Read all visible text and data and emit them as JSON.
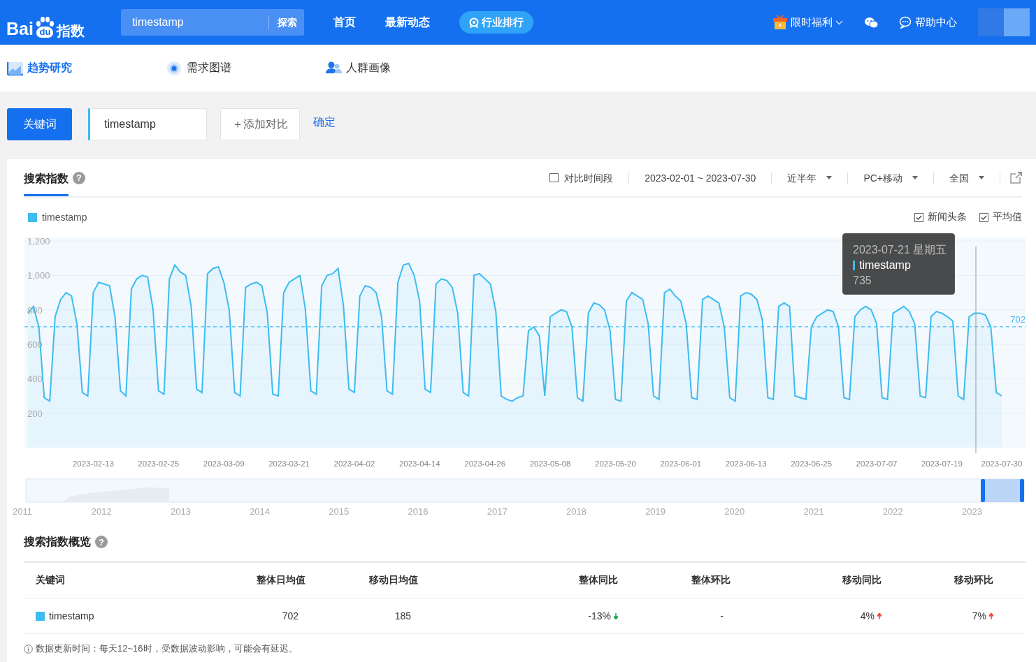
{
  "header": {
    "logo": [
      "Bai",
      "du",
      "指数"
    ],
    "search": {
      "value": "timestamp",
      "button": "探索"
    },
    "nav": [
      {
        "label": "首页",
        "kind": "link"
      },
      {
        "label": "最新动态",
        "kind": "link"
      },
      {
        "label": "行业排行",
        "kind": "pill"
      }
    ],
    "right": [
      {
        "label": "限时福利",
        "kind": "gift"
      },
      {
        "kind": "wechat"
      },
      {
        "label": "帮助中心",
        "kind": "help"
      },
      {
        "kind": "avatar"
      }
    ]
  },
  "subnav": [
    {
      "label": "趋势研究",
      "selected": true,
      "kind": "trend"
    },
    {
      "label": "需求图谱",
      "selected": false,
      "kind": "graph"
    },
    {
      "label": "人群画像",
      "selected": false,
      "kind": "people"
    }
  ],
  "keyword_bar": {
    "mode_button": "关键词",
    "keyword": "timestamp",
    "add_button": "＋添加对比",
    "confirm": "确定"
  },
  "trend": {
    "title": "搜索指数",
    "help": "?",
    "compare_period": {
      "label": "对比时间段",
      "checked": false
    },
    "date_range": "2023-02-01 ~ 2023-07-30",
    "filters": [
      "近半年",
      "PC+移动",
      "全国"
    ],
    "toggles": [
      {
        "label": "新闻头条",
        "checked": true
      },
      {
        "label": "平均值",
        "checked": true
      }
    ],
    "chart_data": {
      "type": "area",
      "grid": true,
      "ylim": [
        0,
        1200
      ],
      "yticks": [
        {
          "value": 200,
          "label": "200"
        },
        {
          "value": 400,
          "label": "400"
        },
        {
          "value": 600,
          "label": "600"
        },
        {
          "value": 800,
          "label": "800"
        },
        {
          "value": 1000,
          "label": "1,000"
        },
        {
          "value": 1200,
          "label": "1,200"
        }
      ],
      "categories": [
        null,
        null,
        null,
        null,
        null,
        null,
        null,
        null,
        null,
        null,
        null,
        null,
        "2023-02-13",
        null,
        null,
        null,
        null,
        null,
        null,
        null,
        null,
        null,
        null,
        null,
        "2023-02-25",
        null,
        null,
        null,
        null,
        null,
        null,
        null,
        null,
        null,
        null,
        null,
        "2023-03-09",
        null,
        null,
        null,
        null,
        null,
        null,
        null,
        null,
        null,
        null,
        null,
        "2023-03-21",
        null,
        null,
        null,
        null,
        null,
        null,
        null,
        null,
        null,
        null,
        null,
        "2023-04-02",
        null,
        null,
        null,
        null,
        null,
        null,
        null,
        null,
        null,
        null,
        null,
        "2023-04-14",
        null,
        null,
        null,
        null,
        null,
        null,
        null,
        null,
        null,
        null,
        null,
        "2023-04-26",
        null,
        null,
        null,
        null,
        null,
        null,
        null,
        null,
        null,
        null,
        null,
        "2023-05-08",
        null,
        null,
        null,
        null,
        null,
        null,
        null,
        null,
        null,
        null,
        null,
        "2023-05-20",
        null,
        null,
        null,
        null,
        null,
        null,
        null,
        null,
        null,
        null,
        null,
        "2023-06-01",
        null,
        null,
        null,
        null,
        null,
        null,
        null,
        null,
        null,
        null,
        null,
        "2023-06-13",
        null,
        null,
        null,
        null,
        null,
        null,
        null,
        null,
        null,
        null,
        null,
        "2023-06-25",
        null,
        null,
        null,
        null,
        null,
        null,
        null,
        null,
        null,
        null,
        null,
        "2023-07-07",
        null,
        null,
        null,
        null,
        null,
        null,
        null,
        null,
        null,
        null,
        null,
        "2023-07-19",
        null,
        null,
        null,
        null,
        null,
        null,
        null,
        null,
        null,
        null,
        "2023-07-30"
      ],
      "series": [
        {
          "name": "timestamp",
          "color": "#3cbcf0",
          "values": [
            780,
            820,
            700,
            290,
            270,
            760,
            860,
            900,
            880,
            720,
            320,
            300,
            900,
            960,
            950,
            940,
            760,
            330,
            300,
            920,
            980,
            1000,
            990,
            800,
            330,
            310,
            980,
            1060,
            1020,
            1000,
            820,
            340,
            320,
            1010,
            1040,
            1050,
            960,
            800,
            320,
            300,
            930,
            950,
            960,
            940,
            780,
            310,
            300,
            900,
            960,
            980,
            1000,
            800,
            330,
            310,
            940,
            1000,
            1010,
            1040,
            820,
            340,
            320,
            880,
            940,
            930,
            900,
            760,
            330,
            310,
            960,
            1060,
            1070,
            1000,
            850,
            340,
            320,
            950,
            980,
            970,
            930,
            780,
            320,
            300,
            1000,
            1010,
            980,
            950,
            790,
            300,
            280,
            270,
            290,
            300,
            680,
            700,
            650,
            300,
            760,
            780,
            800,
            790,
            700,
            290,
            270,
            780,
            840,
            830,
            800,
            680,
            280,
            270,
            850,
            900,
            880,
            860,
            720,
            300,
            280,
            900,
            920,
            880,
            850,
            720,
            290,
            280,
            860,
            880,
            860,
            840,
            700,
            290,
            270,
            880,
            900,
            890,
            860,
            740,
            290,
            280,
            820,
            840,
            820,
            300,
            290,
            280,
            700,
            760,
            780,
            800,
            790,
            700,
            290,
            280,
            760,
            800,
            820,
            800,
            720,
            290,
            280,
            780,
            800,
            820,
            790,
            720,
            300,
            290,
            760,
            790,
            780,
            760,
            735,
            300,
            280,
            760,
            780,
            780,
            770,
            700,
            320,
            300
          ]
        }
      ],
      "ref_lines": [
        {
          "axis": "y",
          "value": 702,
          "label": "702"
        }
      ]
    },
    "tooltip": {
      "date": "2023-07-21 星期五",
      "series": "timestamp",
      "value": "735"
    },
    "overview_years": [
      "2011",
      "2012",
      "2013",
      "2014",
      "2015",
      "2016",
      "2017",
      "2018",
      "2019",
      "2020",
      "2021",
      "2022",
      "2023"
    ]
  },
  "overview": {
    "title": "搜索指数概览",
    "help": "?",
    "columns": [
      "关键词",
      "整体日均值",
      "移动日均值",
      "整体同比",
      "整体环比",
      "移动同比",
      "移动环比"
    ],
    "rows": [
      {
        "cells": [
          {
            "text": "timestamp",
            "color": "#3cbcf0"
          },
          {
            "text": "702"
          },
          {
            "text": "185"
          },
          {
            "text": "-13%",
            "kind": "down"
          },
          {
            "text": "-"
          },
          {
            "text": "4%",
            "kind": "up"
          },
          {
            "text": "7%",
            "kind": "up"
          }
        ]
      }
    ],
    "note": "数据更新时间：每天12~16时，受数据波动影响，可能会有延迟。"
  }
}
